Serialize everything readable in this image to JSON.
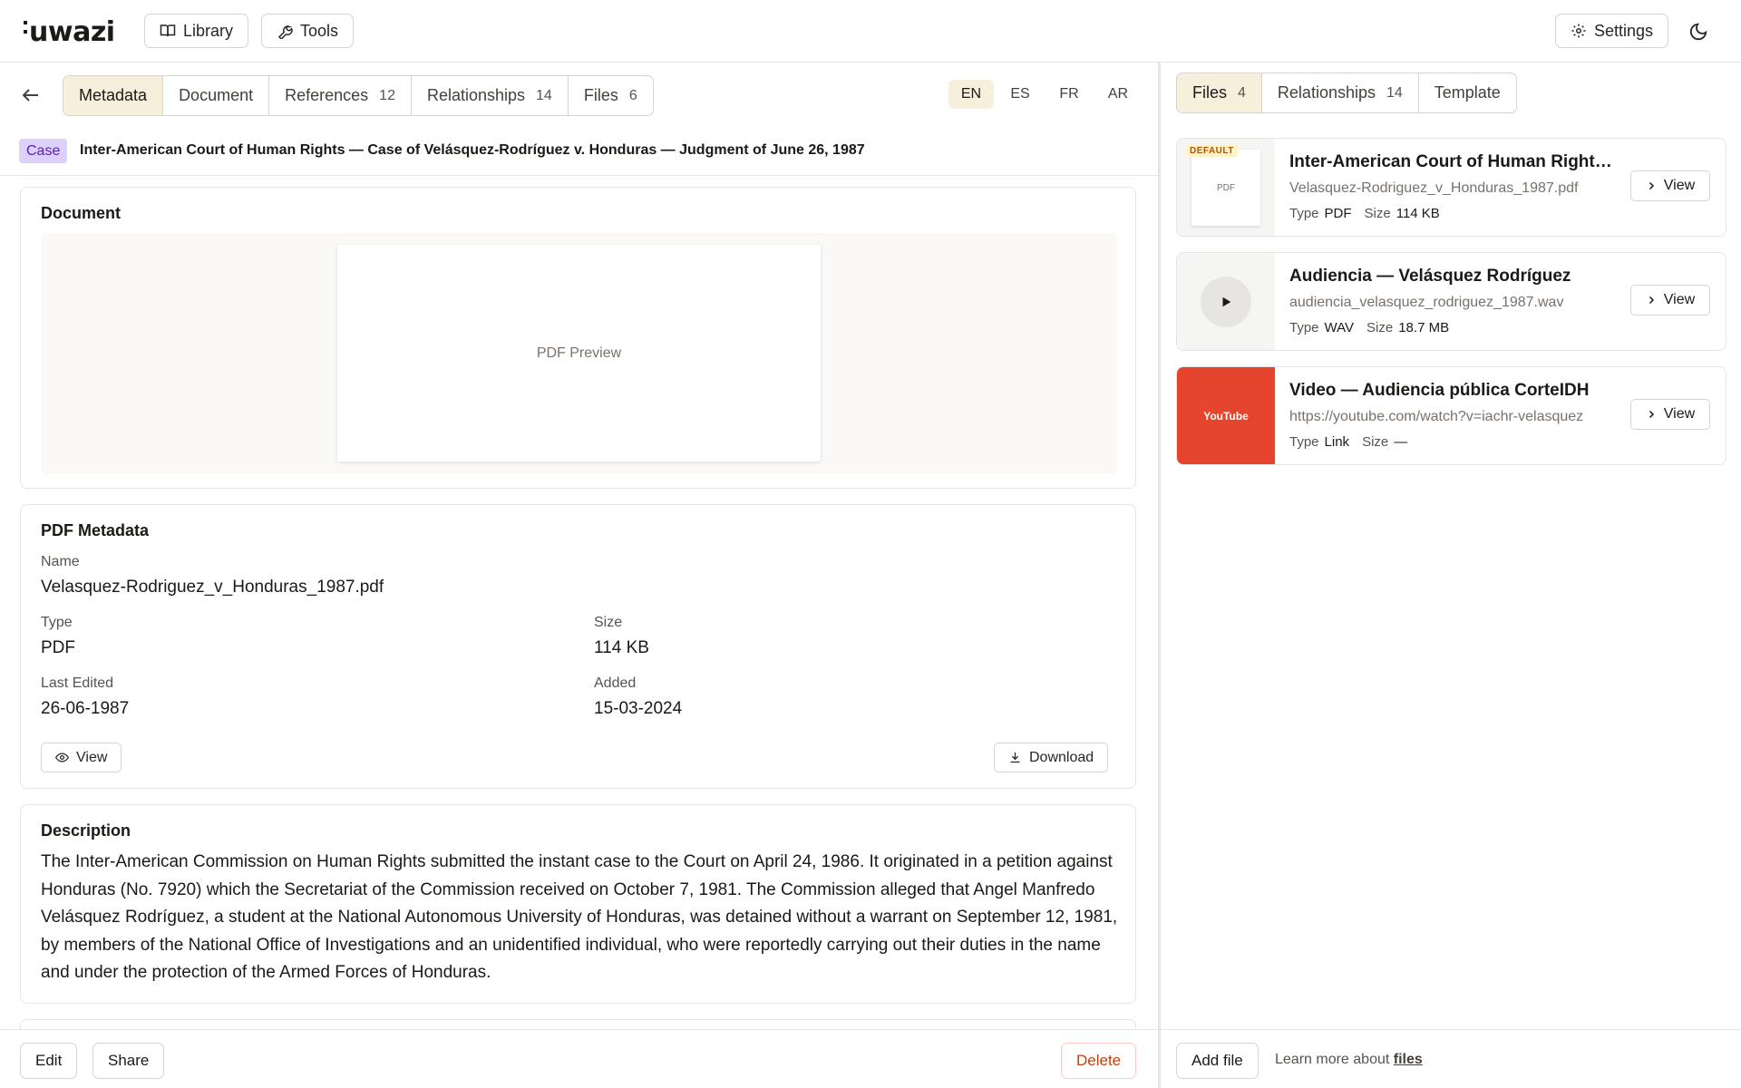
{
  "app": {
    "logo": "uwazi"
  },
  "topbar": {
    "library_label": "Library",
    "tools_label": "Tools",
    "settings_label": "Settings"
  },
  "left": {
    "tabs": [
      {
        "label": "Metadata",
        "count": ""
      },
      {
        "label": "Document",
        "count": ""
      },
      {
        "label": "References",
        "count": "12"
      },
      {
        "label": "Relationships",
        "count": "14"
      },
      {
        "label": "Files",
        "count": "6"
      }
    ],
    "languages": [
      "EN",
      "ES",
      "FR",
      "AR"
    ],
    "entity": {
      "template_badge": "Case",
      "title": "Inter-American Court of Human Rights — Case of Velásquez-Rodríguez v. Honduras — Judgment of June 26, 1987"
    },
    "document_card": {
      "heading": "Document",
      "preview_label": "PDF Preview"
    },
    "pdf_metadata": {
      "heading": "PDF Metadata",
      "name_label": "Name",
      "name_value": "Velasquez-Rodriguez_v_Honduras_1987.pdf",
      "type_label": "Type",
      "type_value": "PDF",
      "size_label": "Size",
      "size_value": "114 KB",
      "last_edited_label": "Last Edited",
      "last_edited_value": "26-06-1987",
      "added_label": "Added",
      "added_value": "15-03-2024",
      "view_label": "View",
      "download_label": "Download"
    },
    "description": {
      "heading": "Description",
      "text": "The Inter-American Commission on Human Rights submitted the instant case to the Court on April 24, 1986. It originated in a petition against Honduras (No. 7920) which the Secretariat of the Commission received on October 7, 1981. The Commission alleged that Angel Manfredo Velásquez Rodríguez, a student at the National Autonomous University of Honduras, was detained without a warrant on September 12, 1981, by members of the National Office of Investigations and an unidentified individual, who were reportedly carrying out their duties in the name and under the protection of the Armed Forces of Honduras."
    },
    "footer": {
      "edit_label": "Edit",
      "share_label": "Share",
      "delete_label": "Delete"
    }
  },
  "right": {
    "tabs": [
      {
        "label": "Files",
        "count": "4"
      },
      {
        "label": "Relationships",
        "count": "14"
      },
      {
        "label": "Template",
        "count": ""
      }
    ],
    "files": [
      {
        "badge": "DEFAULT",
        "thumb_label": "PDF",
        "title": "Inter-American Court of Human Rights — Case of Velásquez-Rodríguez v. Honduras",
        "filename": "Velasquez-Rodriguez_v_Honduras_1987.pdf",
        "type_label": "Type",
        "type_value": "PDF",
        "size_label": "Size",
        "size_value": "114 KB",
        "view_label": "View"
      },
      {
        "title": "Audiencia — Velásquez Rodríguez",
        "filename": "audiencia_velasquez_rodriguez_1987.wav",
        "type_label": "Type",
        "type_value": "WAV",
        "size_label": "Size",
        "size_value": "18.7 MB",
        "view_label": "View"
      },
      {
        "thumb_label": "YouTube",
        "title": "Video — Audiencia pública CorteIDH",
        "filename": "https://youtube.com/watch?v=iachr-velasquez",
        "type_label": "Type",
        "type_value": "Link",
        "size_label": "Size",
        "size_value": "—",
        "view_label": "View"
      }
    ],
    "footer": {
      "add_file_label": "Add file",
      "learn_text": "Learn more about",
      "learn_link": "files"
    }
  }
}
